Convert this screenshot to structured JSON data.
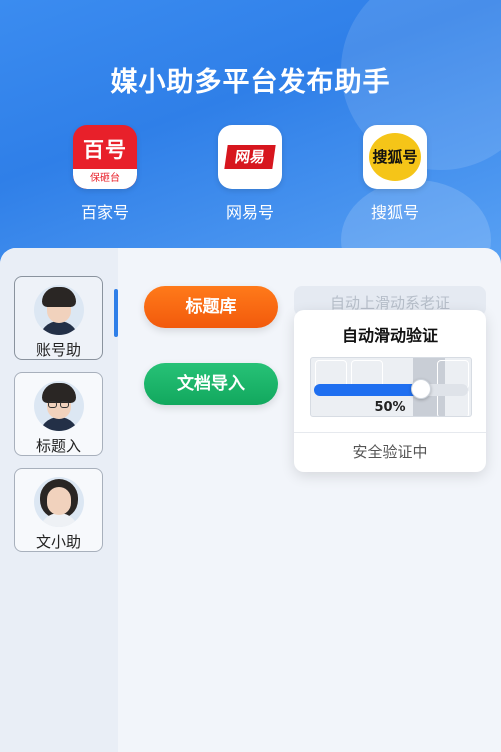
{
  "header": {
    "title": "媒小助多平台发布助手"
  },
  "platforms": [
    {
      "name": "百家号",
      "logo_text": "百号",
      "logo_sub": "保砸台",
      "color": "#e8202a"
    },
    {
      "name": "网易号",
      "logo_text": "网易",
      "color": "#d7161e"
    },
    {
      "name": "搜狐号",
      "logo_text": "搜狐号",
      "color": "#f5c518"
    }
  ],
  "accounts": [
    {
      "name": "账号助",
      "active": true
    },
    {
      "name": "标题入",
      "active": false
    },
    {
      "name": "文小助",
      "active": false
    }
  ],
  "actions": {
    "title_library": "标题库",
    "doc_import": "文档导入"
  },
  "hint_text": "自动上滑动系老证",
  "captcha": {
    "title": "自动滑动验证",
    "progress_label": "50%",
    "progress": 0.5,
    "status": "安全验证中"
  },
  "colors": {
    "header_blue": "#2f7fe8",
    "orange_button": "#f25a0c",
    "green_button": "#12a85e",
    "slider_blue": "#1f6ff0"
  }
}
